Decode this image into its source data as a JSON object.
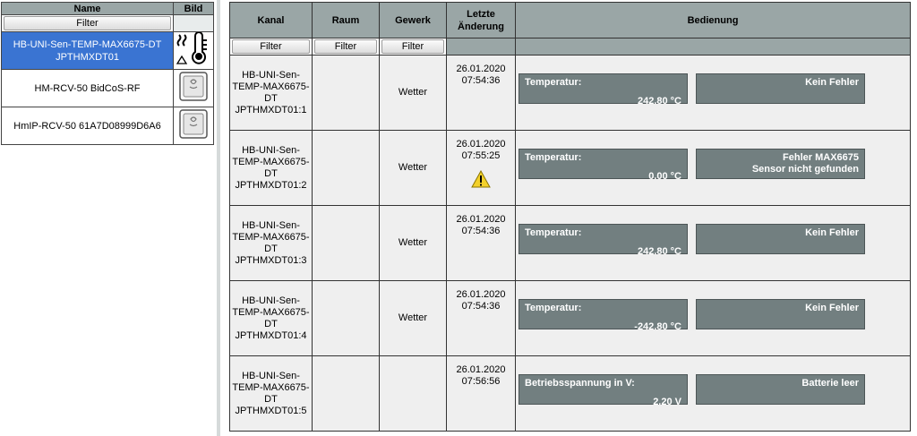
{
  "sidebar": {
    "header_name": "Name",
    "header_bild": "Bild",
    "filter_label": "Filter",
    "devices": [
      {
        "name_line1": "HB-UNI-Sen-TEMP-MAX6675-DT",
        "name_line2": "JPTHMXDT01",
        "icon": "thermometer-icon",
        "selected": true
      },
      {
        "name_line1": "HM-RCV-50 BidCoS-RF",
        "name_line2": "",
        "icon": "device-icon",
        "selected": false
      },
      {
        "name_line1": "HmIP-RCV-50 61A7D08999D6A6",
        "name_line2": "",
        "icon": "device-icon",
        "selected": false
      }
    ]
  },
  "table": {
    "headers": {
      "kanal": "Kanal",
      "raum": "Raum",
      "gewerk": "Gewerk",
      "letzte_line1": "Letzte",
      "letzte_line2": "Änderung",
      "bedienung": "Bedienung"
    },
    "filter_label": "Filter",
    "rows": [
      {
        "kanal": [
          "HB-UNI-Sen-",
          "TEMP-MAX6675-",
          "DT",
          "JPTHMXDT01:1"
        ],
        "raum": "",
        "gewerk": "Wetter",
        "date": "26.01.2020",
        "time": "07:54:36",
        "warning": false,
        "left_label": "Temperatur:",
        "left_value": "242.80 °C",
        "right_line1": "Kein Fehler",
        "right_line2": ""
      },
      {
        "kanal": [
          "HB-UNI-Sen-",
          "TEMP-MAX6675-",
          "DT",
          "JPTHMXDT01:2"
        ],
        "raum": "",
        "gewerk": "Wetter",
        "date": "26.01.2020",
        "time": "07:55:25",
        "warning": true,
        "left_label": "Temperatur:",
        "left_value": "0.00 °C",
        "right_line1": "Fehler MAX6675",
        "right_line2": "Sensor nicht gefunden"
      },
      {
        "kanal": [
          "HB-UNI-Sen-",
          "TEMP-MAX6675-",
          "DT",
          "JPTHMXDT01:3"
        ],
        "raum": "",
        "gewerk": "Wetter",
        "date": "26.01.2020",
        "time": "07:54:36",
        "warning": false,
        "left_label": "Temperatur:",
        "left_value": "242.80 °C",
        "right_line1": "Kein Fehler",
        "right_line2": ""
      },
      {
        "kanal": [
          "HB-UNI-Sen-",
          "TEMP-MAX6675-",
          "DT",
          "JPTHMXDT01:4"
        ],
        "raum": "",
        "gewerk": "Wetter",
        "date": "26.01.2020",
        "time": "07:54:36",
        "warning": false,
        "left_label": "Temperatur:",
        "left_value": "-242.80 °C",
        "right_line1": "Kein Fehler",
        "right_line2": ""
      },
      {
        "kanal": [
          "HB-UNI-Sen-",
          "TEMP-MAX6675-",
          "DT",
          "JPTHMXDT01:5"
        ],
        "raum": "",
        "gewerk": "",
        "date": "26.01.2020",
        "time": "07:56:56",
        "warning": false,
        "left_label": "Betriebsspannung in V:",
        "left_value": "2.20 V",
        "right_line1": "Batterie leer",
        "right_line2": ""
      }
    ]
  },
  "colors": {
    "header_bg": "#9aa6a6",
    "selected_bg": "#3a74d2",
    "control_box_bg": "#727f80",
    "row_bg": "#efefef",
    "warning": "#f3d12a"
  }
}
